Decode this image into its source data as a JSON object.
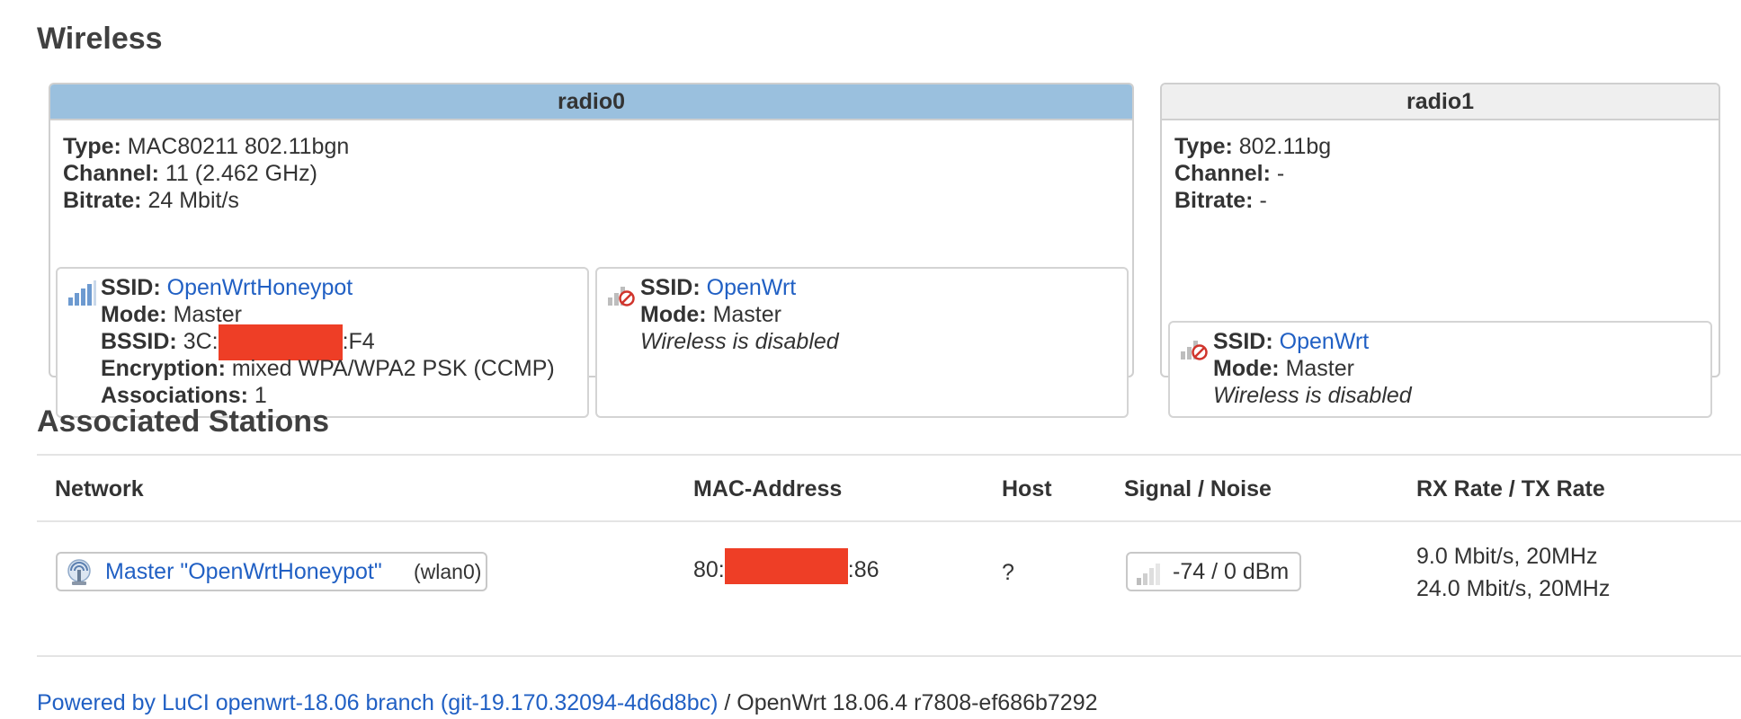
{
  "wireless": {
    "title": "Wireless",
    "radios": [
      {
        "name": "radio0",
        "type_label": "Type:",
        "type_value": "MAC80211 802.11bgn",
        "channel_label": "Channel:",
        "channel_value": "11 (2.462 GHz)",
        "bitrate_label": "Bitrate:",
        "bitrate_value": "24 Mbit/s",
        "networks": [
          {
            "ssid_label": "SSID:",
            "ssid_value": "OpenWrtHoneypot",
            "mode_label": "Mode:",
            "mode_value": "Master",
            "bssid_label": "BSSID:",
            "bssid_prefix": "3C:",
            "bssid_suffix": ":F4",
            "encryption_label": "Encryption:",
            "encryption_value": "mixed WPA/WPA2 PSK (CCMP)",
            "assoc_label": "Associations:",
            "assoc_value": "1",
            "icon": "signal-strength-icon"
          },
          {
            "ssid_label": "SSID:",
            "ssid_value": "OpenWrt",
            "mode_label": "Mode:",
            "mode_value": "Master",
            "status": "Wireless is disabled",
            "icon": "wifi-disabled-icon"
          }
        ]
      },
      {
        "name": "radio1",
        "type_label": "Type:",
        "type_value": "802.11bg",
        "channel_label": "Channel:",
        "channel_value": "-",
        "bitrate_label": "Bitrate:",
        "bitrate_value": "-",
        "networks": [
          {
            "ssid_label": "SSID:",
            "ssid_value": "OpenWrt",
            "mode_label": "Mode:",
            "mode_value": "Master",
            "status": "Wireless is disabled",
            "icon": "wifi-disabled-icon"
          }
        ]
      }
    ]
  },
  "stations": {
    "title": "Associated Stations",
    "columns": [
      "Network",
      "MAC-Address",
      "Host",
      "Signal / Noise",
      "RX Rate / TX Rate"
    ],
    "rows": [
      {
        "network_link": "Master \"OpenWrtHoneypot\"",
        "network_iface": "(wlan0)",
        "mac_prefix": "80:",
        "mac_suffix": ":86",
        "host": "?",
        "signal": "-74 / 0 dBm",
        "rx_rate": "9.0 Mbit/s, 20MHz",
        "tx_rate": "24.0 Mbit/s, 20MHz"
      }
    ]
  },
  "footer": {
    "link_text": "Powered by LuCI openwrt-18.06 branch (git-19.170.32094-4d6d8bc)",
    "separator": " / ",
    "version_text": "OpenWrt 18.06.4 r7808-ef686b7292"
  },
  "colors": {
    "link": "#2160c4",
    "radio_active_header": "#9ac0de",
    "radio_inactive_header": "#efefef",
    "redaction": "#ee3e26"
  }
}
